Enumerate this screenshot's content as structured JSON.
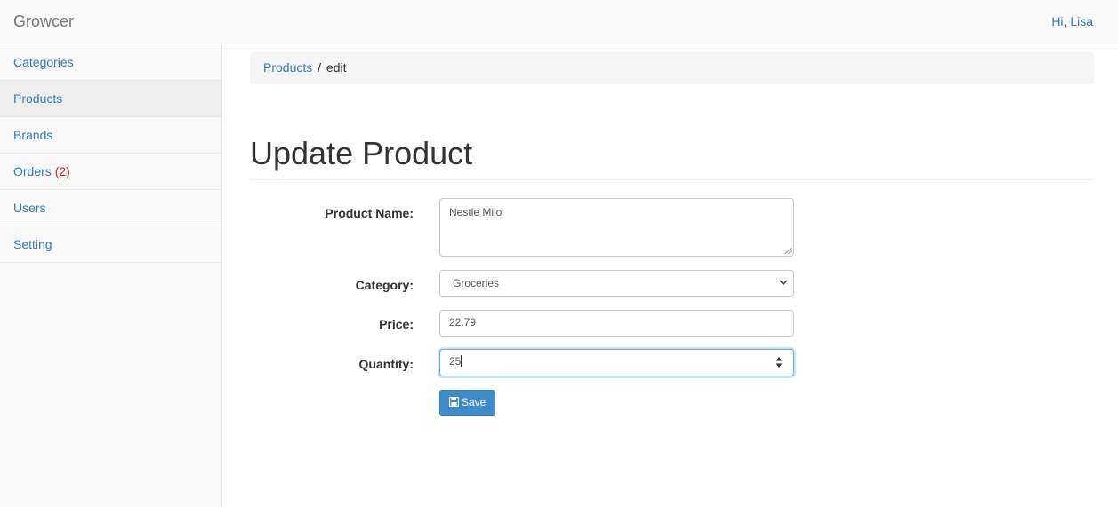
{
  "navbar": {
    "brand": "Growcer",
    "greeting": "Hi, Lisa"
  },
  "sidebar": {
    "items": [
      {
        "label": "Categories"
      },
      {
        "label": "Products",
        "active": true
      },
      {
        "label": "Brands"
      },
      {
        "label": "Orders",
        "badge": "(2)"
      },
      {
        "label": "Users"
      },
      {
        "label": "Setting"
      }
    ]
  },
  "breadcrumb": {
    "link": "Products",
    "separator": "/",
    "current": "edit"
  },
  "page": {
    "title": "Update Product"
  },
  "form": {
    "product_name": {
      "label": "Product Name:",
      "value": "Nestle Milo"
    },
    "category": {
      "label": "Category:",
      "value": "Groceries"
    },
    "price": {
      "label": "Price:",
      "value": "22.79"
    },
    "quantity": {
      "label": "Quantity:",
      "value": "25"
    },
    "save_label": "Save"
  },
  "colors": {
    "link": "#337ab7",
    "primary_button": "#428bca",
    "badge": "#d9230f"
  },
  "icons": [
    "save-icon",
    "chevron-down-icon",
    "spinner-arrows-icon"
  ]
}
